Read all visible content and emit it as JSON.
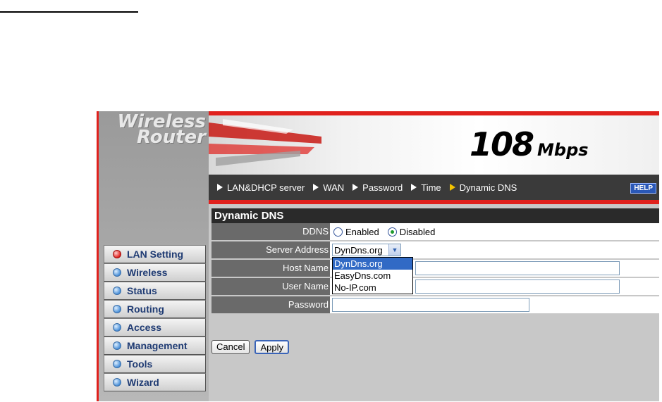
{
  "header": {
    "logo_line1": "Wireless",
    "logo_line2": "Router",
    "speed_value": "108",
    "speed_unit": "Mbps",
    "help_label": "HELP"
  },
  "nav": {
    "items": [
      {
        "label": "LAN&DHCP server"
      },
      {
        "label": "WAN"
      },
      {
        "label": "Password"
      },
      {
        "label": "Time"
      },
      {
        "label": "Dynamic DNS",
        "active": true
      }
    ]
  },
  "sidebar": {
    "items": [
      {
        "label": "LAN Setting",
        "active": true
      },
      {
        "label": "Wireless"
      },
      {
        "label": "Status"
      },
      {
        "label": "Routing"
      },
      {
        "label": "Access"
      },
      {
        "label": "Management"
      },
      {
        "label": "Tools"
      },
      {
        "label": "Wizard"
      }
    ]
  },
  "form": {
    "title": "Dynamic DNS",
    "ddns_label": "DDNS",
    "ddns_enabled_label": "Enabled",
    "ddns_disabled_label": "Disabled",
    "ddns_selected": "Disabled",
    "server_label": "Server Address",
    "server_value": "DynDns.org",
    "server_options": [
      "DynDns.org",
      "EasyDns.com",
      "No-IP.com"
    ],
    "host_label": "Host Name",
    "host_value": "",
    "user_label": "User Name",
    "user_value": "",
    "password_label": "Password",
    "password_value": ""
  },
  "buttons": {
    "cancel": "Cancel",
    "apply": "Apply"
  },
  "colors": {
    "accent_red": "#e0211d",
    "nav_bg": "#3a3a3a",
    "label_bg": "#6a6a6a",
    "selected_option": "#316ac5"
  }
}
